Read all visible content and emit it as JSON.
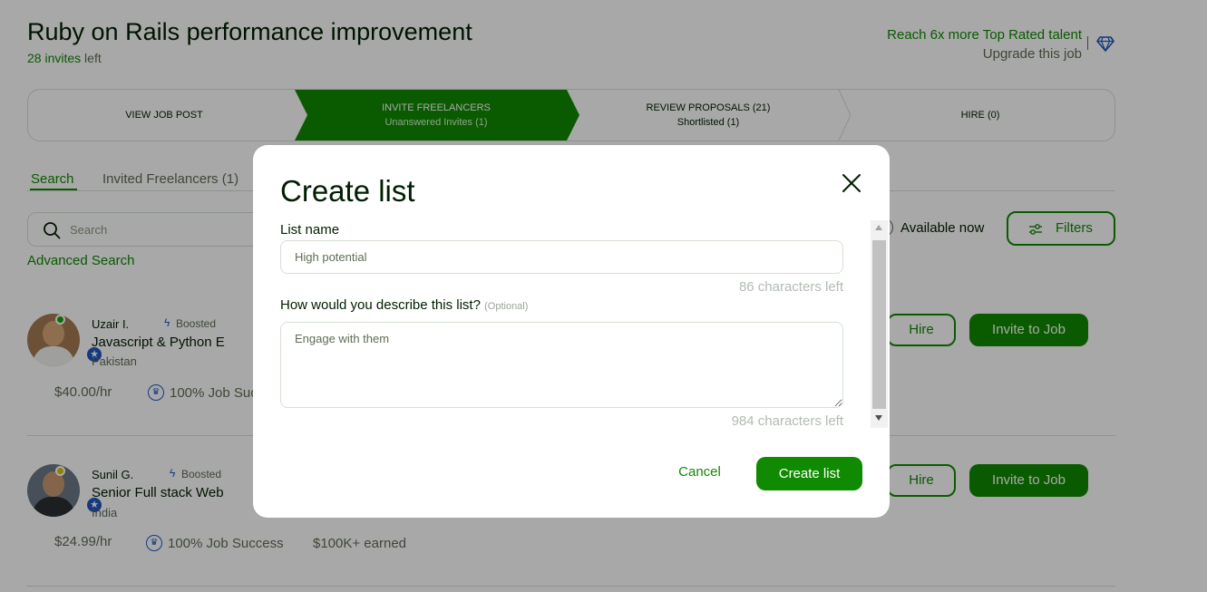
{
  "header": {
    "job_title": "Ruby on Rails performance improvement",
    "invites_count": "28 invites",
    "invites_suffix": " left",
    "upsell_reach": "Reach 6x more Top Rated talent",
    "upsell_upgrade": "Upgrade this job"
  },
  "stepper": {
    "steps": [
      {
        "label": "VIEW JOB POST",
        "sub": ""
      },
      {
        "label": "INVITE FREELANCERS",
        "sub": "Unanswered Invites (1)"
      },
      {
        "label": "REVIEW PROPOSALS (21)",
        "sub": "Shortlisted (1)"
      },
      {
        "label": "HIRE (0)",
        "sub": ""
      }
    ],
    "active_index": 1
  },
  "tabs": [
    {
      "label": "Search"
    },
    {
      "label": "Invited Freelancers (1)"
    }
  ],
  "search": {
    "placeholder": "Search",
    "advanced_label": "Advanced Search",
    "available_now_label": "Available now",
    "filters_label": "Filters"
  },
  "freelancers": [
    {
      "name": "Uzair I.",
      "boosted": "Boosted",
      "title": "Javascript & Python E",
      "country": "Pakistan",
      "rate": "$40.00/hr",
      "job_success": "100% Job Suc",
      "earned": "",
      "status_color": "#14a800",
      "hire_label": "Hire",
      "invite_label": "Invite to Job"
    },
    {
      "name": "Sunil G.",
      "boosted": "Boosted",
      "title": "Senior Full stack Web",
      "country": "India",
      "rate": "$24.99/hr",
      "job_success": "100% Job Success",
      "earned": "$100K+ earned",
      "status_color": "#e0c200",
      "hire_label": "Hire",
      "invite_label": "Invite to Job"
    }
  ],
  "modal": {
    "title": "Create list",
    "list_name_label": "List name",
    "list_name_placeholder": "High potential",
    "list_name_chars_left": "86 characters left",
    "description_label": "How would you describe this list?",
    "description_optional": "(Optional)",
    "description_placeholder": "Engage with them",
    "description_chars_left": "984 characters left",
    "cancel_label": "Cancel",
    "create_label": "Create list"
  },
  "colors": {
    "brand_green": "#108a00",
    "badge_blue": "#1f57c3"
  }
}
